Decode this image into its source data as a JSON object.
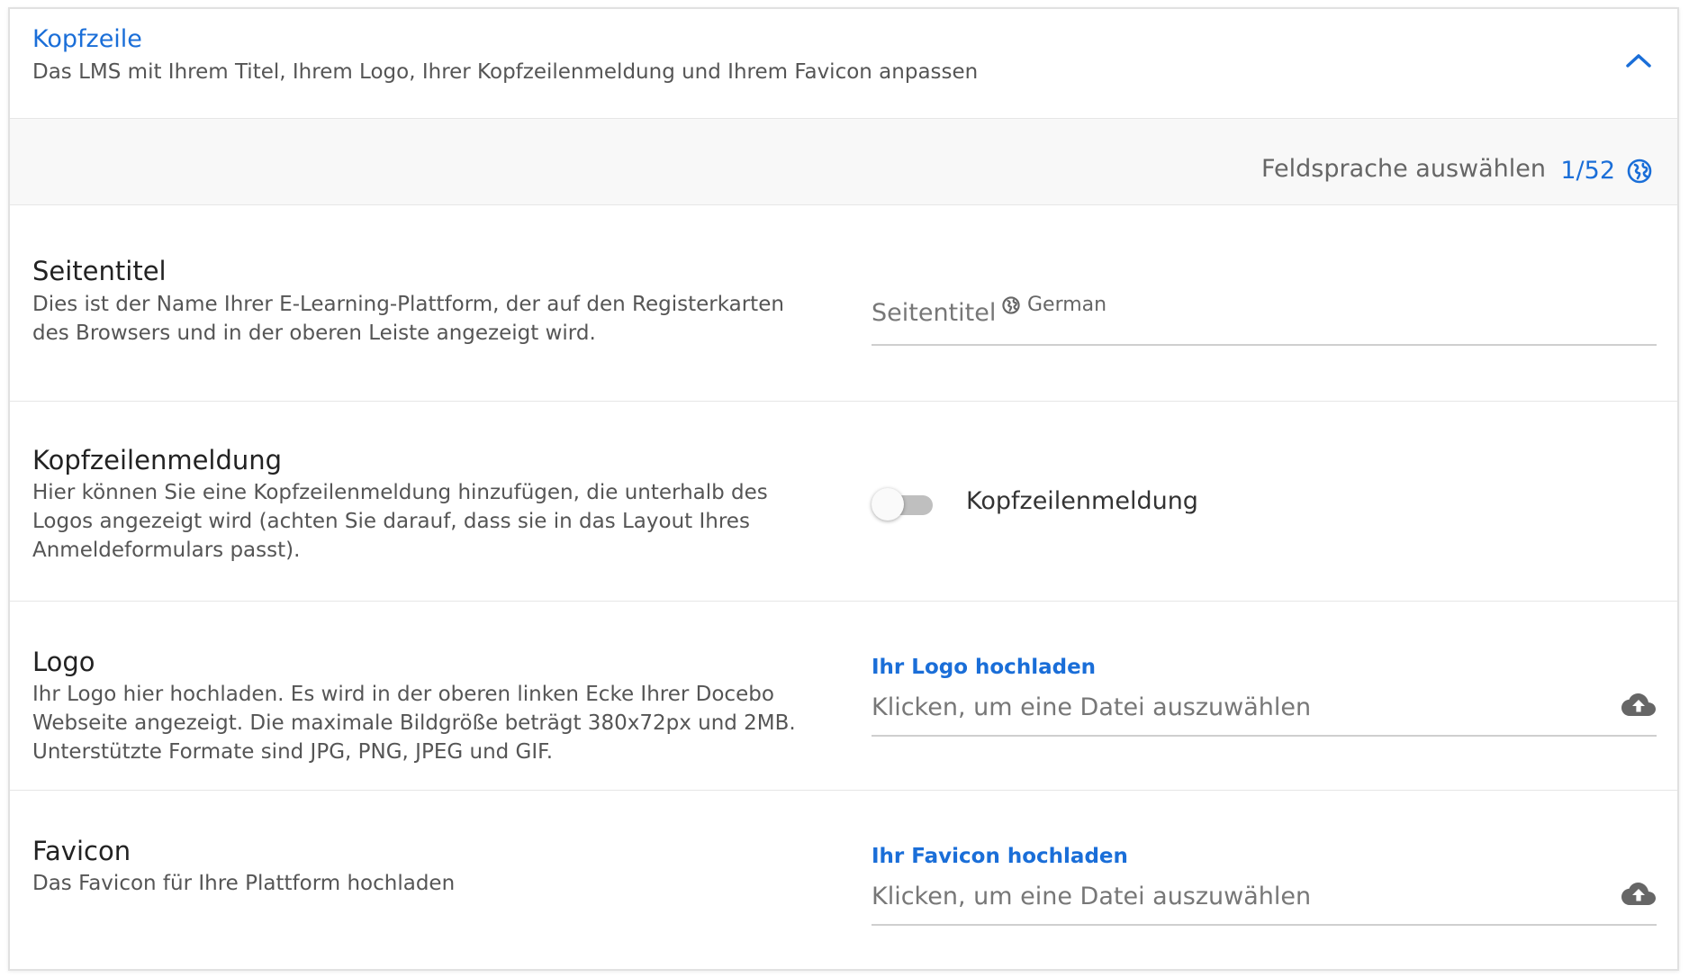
{
  "header": {
    "title": "Kopfzeile",
    "subtitle": "Das LMS mit Ihrem Titel, Ihrem Logo, Ihrer Kopfzeilenmeldung und Ihrem Favicon anpassen"
  },
  "language_bar": {
    "label": "Feldsprache auswählen",
    "count": "1/52"
  },
  "page_title_section": {
    "title": "Seitentitel",
    "description": "Dies ist der Name Ihrer E-Learning-Plattform, der auf den Registerkarten des Browsers und in der oberen Leiste angezeigt wird.",
    "input_placeholder": "Seitentitel",
    "input_language": "German"
  },
  "header_message_section": {
    "title": "Kopfzeilenmeldung",
    "description": "Hier können Sie eine Kopfzeilenmeldung hinzufügen, die unterhalb des Logos angezeigt wird (achten Sie darauf, dass sie in das Layout Ihres Anmeldeformulars passt).",
    "toggle_label": "Kopfzeilenmeldung",
    "toggle_on": false
  },
  "logo_section": {
    "title": "Logo",
    "description": "Ihr Logo hier hochladen. Es wird in der oberen linken Ecke Ihrer Docebo Webseite angezeigt. Die maximale Bildgröße beträgt 380x72px und 2MB. Unterstützte Formate sind JPG, PNG, JPEG und GIF.",
    "upload_label": "Ihr Logo hochladen",
    "upload_placeholder": "Klicken, um eine Datei auszuwählen"
  },
  "favicon_section": {
    "title": "Favicon",
    "description": "Das Favicon für Ihre Plattform hochladen",
    "upload_label": "Ihr Favicon hochladen",
    "upload_placeholder": "Klicken, um eine Datei auszuwählen"
  },
  "colors": {
    "accent": "#1a6ed8",
    "divider": "#e6e6e6",
    "toggle_off": "#bfbfbf",
    "upload_icon": "#666666"
  },
  "icons": {
    "collapse": "chevron-up-icon",
    "language": "globe-icon",
    "upload": "cloud-upload-icon"
  }
}
